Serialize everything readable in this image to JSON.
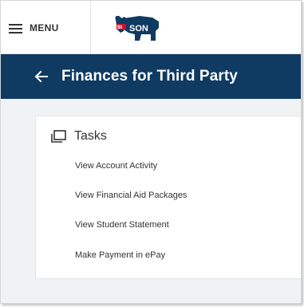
{
  "topbar": {
    "menu_label": "MENU",
    "logo_text": "BISON"
  },
  "header": {
    "title": "Finances for Third Party"
  },
  "tasks_card": {
    "title": "Tasks",
    "items": [
      {
        "label": "View Account Activity"
      },
      {
        "label": "View Financial Aid Packages"
      },
      {
        "label": "View Student Statement"
      },
      {
        "label": "Make Payment in ePay"
      }
    ]
  },
  "colors": {
    "header_bg": "#0f3b63",
    "page_bg": "#f1f2f3",
    "logo_red": "#c8102e",
    "logo_navy": "#0f3b63"
  }
}
